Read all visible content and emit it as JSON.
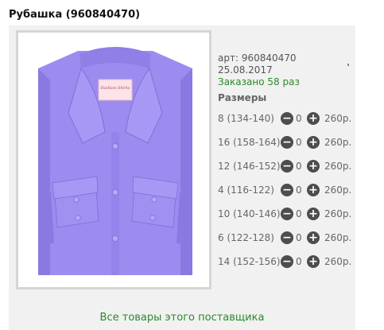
{
  "product": {
    "title": "Рубашка (960840470)",
    "article": "арт: 960840470",
    "date": "25.08.2017",
    "ordered": "Заказано 58 раз",
    "label_text": "Fashion Shirts"
  },
  "sizes": {
    "heading": "Размеры",
    "items": [
      {
        "label": "8 (134-140)",
        "qty": "0",
        "price": "260р."
      },
      {
        "label": "16 (158-164)",
        "qty": "0",
        "price": "260р."
      },
      {
        "label": "12 (146-152)",
        "qty": "0",
        "price": "260р."
      },
      {
        "label": "4 (116-122)",
        "qty": "0",
        "price": "260р."
      },
      {
        "label": "10 (140-146)",
        "qty": "0",
        "price": "260р."
      },
      {
        "label": "6 (122-128)",
        "qty": "0",
        "price": "260р."
      },
      {
        "label": "14 (152-156)",
        "qty": "0",
        "price": "260р."
      }
    ],
    "minus_symbol": "−",
    "plus_symbol": "+"
  },
  "footer": {
    "vendor_link": "Все товары этого поставщика"
  },
  "colors": {
    "shirt": "#9c8cf0",
    "accent_green": "#2a8a2a",
    "button_dark": "#4d4d4d"
  },
  "icons": {
    "minus": "minus-circle-icon",
    "plus": "plus-circle-icon"
  }
}
